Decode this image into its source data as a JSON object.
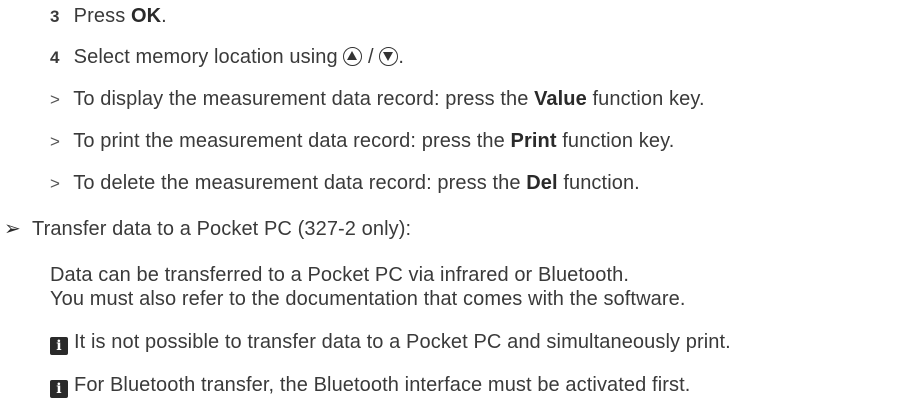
{
  "steps": [
    {
      "number": "3",
      "pre": "Press ",
      "bold": "OK",
      "post": "."
    },
    {
      "number": "4",
      "pre": "Select memory location using ",
      "sep": " / ",
      "post": "."
    }
  ],
  "results": [
    {
      "marker": ">",
      "pre": "To display the measurement data record: press the ",
      "bold": "Value",
      "post": " function key."
    },
    {
      "marker": ">",
      "pre": "To print the measurement data record: press the ",
      "bold": "Print",
      "post": " function key."
    },
    {
      "marker": ">",
      "pre": "To delete the measurement data record: press the ",
      "bold": "Del",
      "post": " function."
    }
  ],
  "action": {
    "marker": "➢",
    "text": "Transfer data to a Pocket PC (327-2 only):"
  },
  "paragraph": [
    "Data can be transferred to a Pocket PC via infrared or Bluetooth.",
    "You must also refer to the documentation that comes with the software."
  ],
  "notes": [
    {
      "icon": "i",
      "text": "It is not possible to transfer data to a Pocket PC and simultaneously print."
    },
    {
      "icon": "i",
      "text": "For Bluetooth transfer, the Bluetooth interface must be activated first."
    }
  ],
  "icons": {
    "up": "arrow-up-circle-icon",
    "down": "arrow-down-circle-icon",
    "info": "info-icon",
    "action": "action-arrow-icon"
  }
}
